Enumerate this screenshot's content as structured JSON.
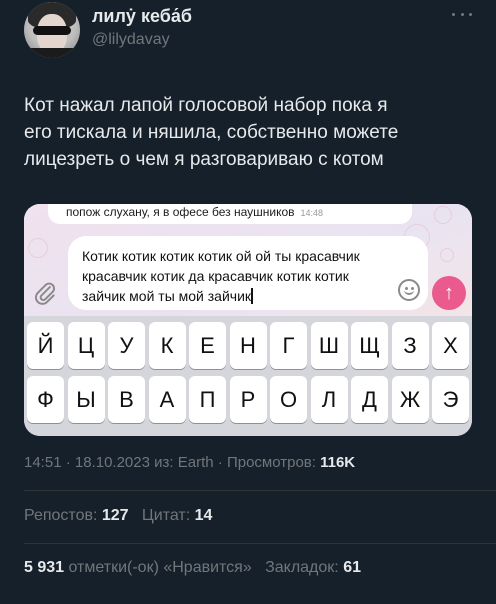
{
  "author": {
    "display_name": "лилẏ кеба́б",
    "handle": "@lilydavay"
  },
  "tweet": {
    "lines": [
      "Кот нажал лапой голосовой набор пока я",
      "его тискала и няшила, собственно можете",
      "лицезреть о чем я разговариваю с котом"
    ]
  },
  "screenshot": {
    "previous_message": "попож слухану, я в офесе без наушников",
    "previous_message_time": "14:48",
    "input_lines": [
      "Котик котик котик котик ой ой ты красавчик",
      "красавчик котик да красавчик котик котик",
      "зайчик мой ты мой зайчик"
    ],
    "send_icon": "arrow-up-icon",
    "keyboard_rows": [
      [
        "Й",
        "Ц",
        "У",
        "К",
        "Е",
        "Н",
        "Г",
        "Ш",
        "Щ",
        "З",
        "Х"
      ],
      [
        "Ф",
        "Ы",
        "В",
        "А",
        "П",
        "Р",
        "О",
        "Л",
        "Д",
        "Ж",
        "Э"
      ]
    ]
  },
  "meta": {
    "time": "14:51",
    "date": "18.10.2023",
    "source_prefix": "из:",
    "source": "Earth",
    "views_label": "Просмотров:",
    "views": "116K"
  },
  "stats": {
    "reposts_label": "Репостов:",
    "reposts": "127",
    "quotes_label": "Цитат:",
    "quotes": "14",
    "likes": "5 931",
    "likes_label": "отметки(-ок) «Нравится»",
    "bookmarks_label": "Закладок:",
    "bookmarks": "61"
  },
  "colors": {
    "background": "#15202b",
    "text": "#e7e9ea",
    "muted": "#71767b",
    "send_button": "#ea5a8c"
  }
}
